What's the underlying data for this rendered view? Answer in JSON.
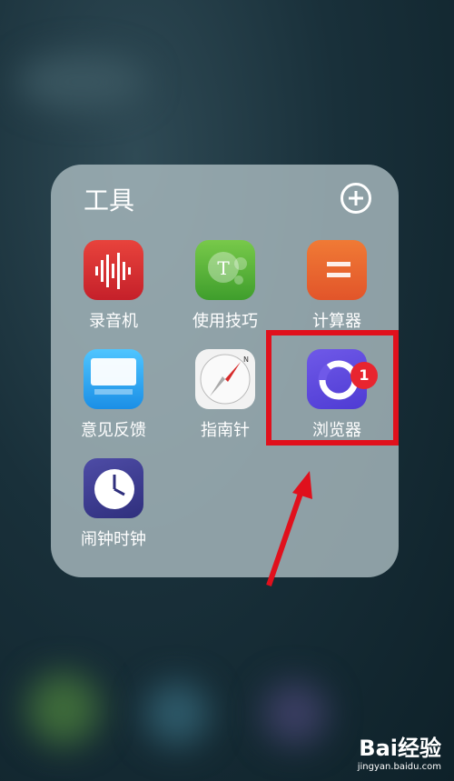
{
  "folder": {
    "title": "工具",
    "apps": [
      {
        "label": "录音机"
      },
      {
        "label": "使用技巧"
      },
      {
        "label": "计算器"
      },
      {
        "label": "意见反馈"
      },
      {
        "label": "指南针"
      },
      {
        "label": "浏览器",
        "badge": "1"
      },
      {
        "label": "闹钟时钟"
      }
    ]
  },
  "tips_icon_letter": "T",
  "watermark": {
    "logo": "Bai经验",
    "url": "jingyan.baidu.com"
  },
  "colors": {
    "highlight": "#e0101c",
    "badge": "#e8252f"
  }
}
